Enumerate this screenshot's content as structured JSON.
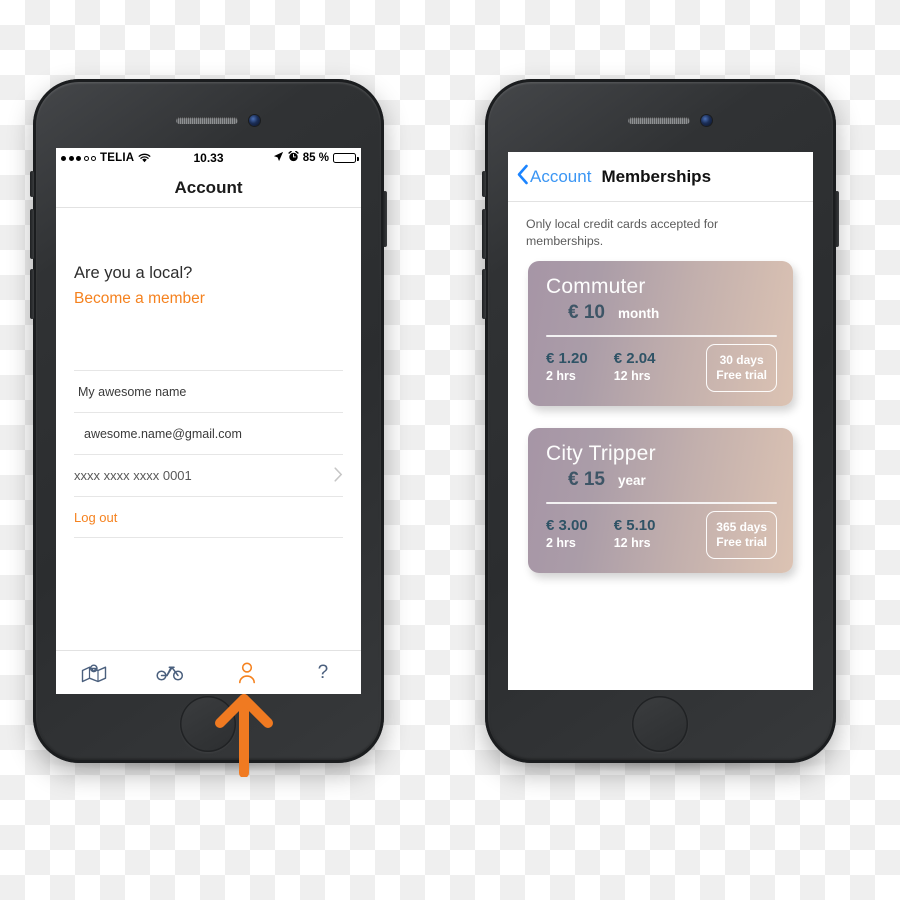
{
  "phone_left": {
    "status_bar": {
      "signal_dots_filled": 3,
      "signal_dots_empty": 2,
      "carrier": "TELIA",
      "wifi_icon": "wifi-icon",
      "time": "10.33",
      "location_icon": "location-arrow-icon",
      "alarm_icon": "alarm-clock-icon",
      "battery_percent": "85 %",
      "battery_level": 85
    },
    "navbar": {
      "title": "Account"
    },
    "promo": {
      "question": "Are you a local?",
      "action": "Become a member",
      "action_color": "#f5821f"
    },
    "rows": [
      {
        "name": "name-row",
        "value": "My awesome name",
        "chevron": false
      },
      {
        "name": "email-row",
        "value": "awesome.name@gmail.com",
        "chevron": false
      },
      {
        "name": "card-row",
        "value": "xxxx xxxx xxxx 0001",
        "chevron": true
      },
      {
        "name": "logout-row",
        "value": "Log out",
        "chevron": false
      }
    ],
    "tabbar": [
      {
        "icon": "map-icon",
        "active": false
      },
      {
        "icon": "bicycle-icon",
        "active": false
      },
      {
        "icon": "person-icon",
        "active": true
      },
      {
        "icon": "question-mark-icon",
        "label": "?",
        "active": false
      }
    ],
    "active_tab_color": "#f5821f",
    "inactive_tab_color": "#4a5f7d"
  },
  "phone_right": {
    "navbar": {
      "back_icon": "chevron-left-icon",
      "back_label": "Account",
      "title": "Memberships",
      "link_color": "#3b96f4"
    },
    "note": "Only local credit cards accepted for memberships.",
    "cards": [
      {
        "title": "Commuter",
        "currency": "€",
        "price": "10",
        "period": "month",
        "rates": [
          {
            "amount": "€ 1.20",
            "duration": "2 hrs"
          },
          {
            "amount": "€ 2.04",
            "duration": "12 hrs"
          }
        ],
        "trial_days": "30 days",
        "trial_label": "Free trial"
      },
      {
        "title": "City Tripper",
        "currency": "€",
        "price": "15",
        "period": "year",
        "rates": [
          {
            "amount": "€ 3.00",
            "duration": "2 hrs"
          },
          {
            "amount": "€ 5.10",
            "duration": "12 hrs"
          }
        ],
        "trial_days": "365 days",
        "trial_label": "Free trial"
      }
    ],
    "card_gradient_start": "#a695a6",
    "card_gradient_end": "#dcc3b3",
    "card_price_color": "#3d5566"
  },
  "annotation": {
    "arrow_icon": "up-arrow-annotation",
    "arrow_color": "#f07a21"
  }
}
